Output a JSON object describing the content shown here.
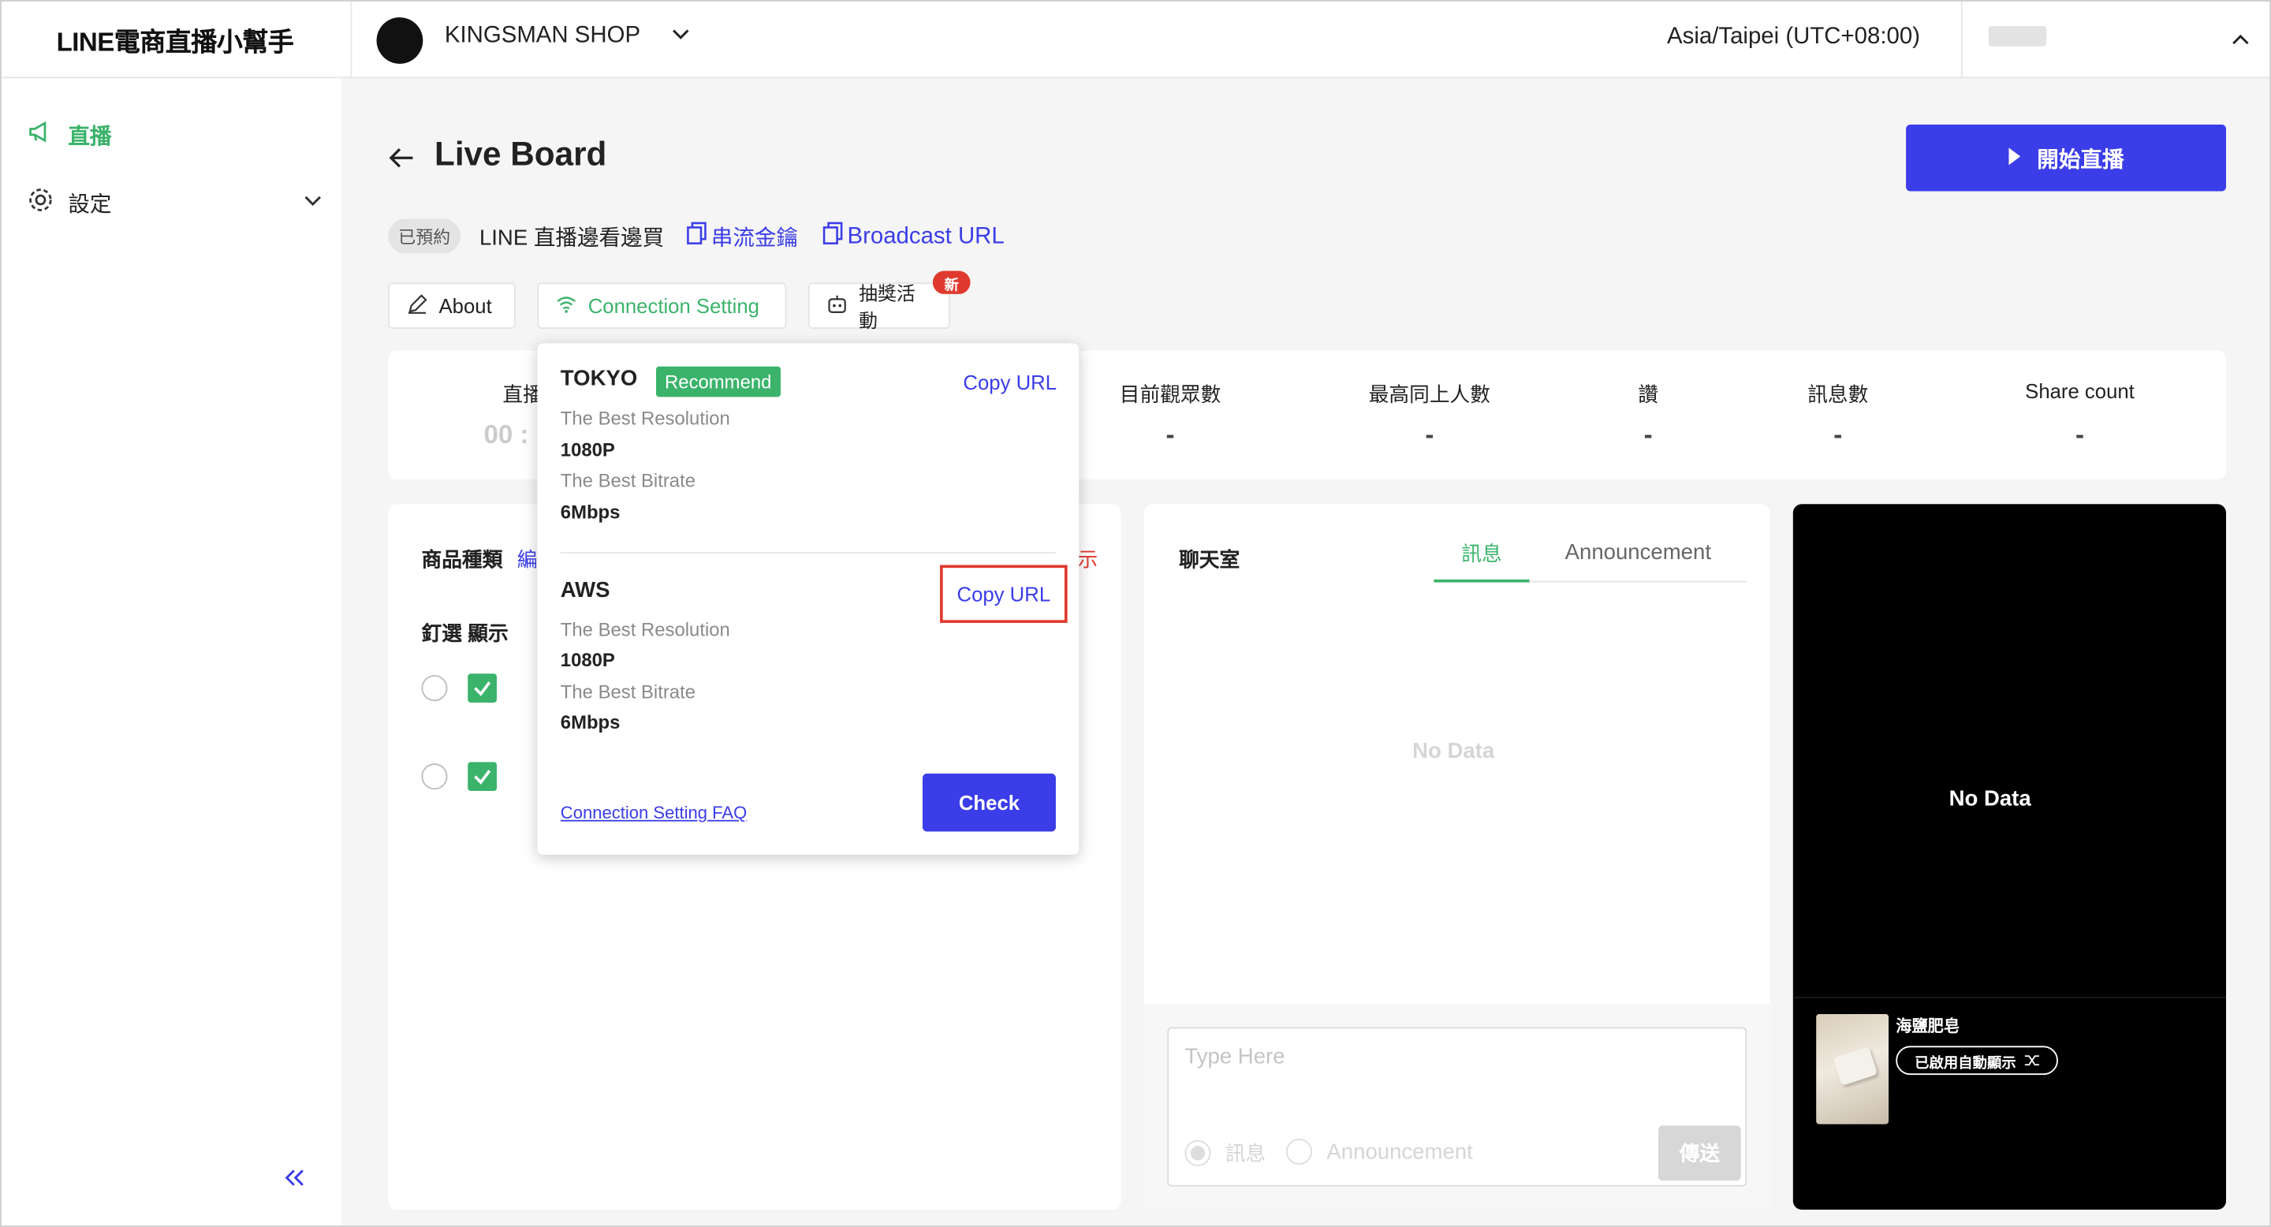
{
  "header": {
    "logo": "LINE電商直播小幫手",
    "shop_name": "KINGSMAN SHOP",
    "timezone": "Asia/Taipei (UTC+08:00)"
  },
  "sidebar": {
    "items": [
      {
        "label": "直播",
        "icon": "megaphone-icon"
      },
      {
        "label": "設定",
        "icon": "gear-icon"
      }
    ]
  },
  "page": {
    "title": "Live Board",
    "start_button": "開始直播",
    "status_badge": "已預約",
    "live_name": "LINE 直播邊看邊買",
    "stream_key_link": "串流金鑰",
    "broadcast_url_link": "Broadcast URL"
  },
  "tabs": {
    "about": "About",
    "connection": "Connection Setting",
    "lottery": "抽獎活動",
    "new_badge": "新"
  },
  "stats": {
    "items": [
      {
        "label": "直播",
        "value": "00 :"
      },
      {
        "label": "目前觀眾數",
        "value": "-"
      },
      {
        "label": "最高同上人數",
        "value": "-"
      },
      {
        "label": "讚",
        "value": "-"
      },
      {
        "label": "訊息數",
        "value": "-"
      },
      {
        "label": "Share count",
        "value": "-"
      }
    ]
  },
  "products": {
    "title": "商品種類",
    "edit": "編",
    "show_suffix": "示",
    "pin_label": "釘選",
    "display_label": "顯示"
  },
  "chat": {
    "title": "聊天室",
    "tab_messages": "訊息",
    "tab_announcement": "Announcement",
    "empty": "No Data",
    "placeholder": "Type Here",
    "radio_message": "訊息",
    "radio_announcement": "Announcement",
    "send": "傳送"
  },
  "video": {
    "empty": "No Data",
    "product_name": "海鹽肥皂",
    "auto_display": "已啟用自動顯示"
  },
  "popup": {
    "servers": [
      {
        "name": "TOKYO",
        "badge": "Recommend",
        "copy": "Copy URL",
        "res_label": "The Best Resolution",
        "res": "1080P",
        "bitrate_label": "The Best Bitrate",
        "bitrate": "6Mbps"
      },
      {
        "name": "AWS",
        "badge": "",
        "copy": "Copy URL",
        "res_label": "The Best Resolution",
        "res": "1080P",
        "bitrate_label": "The Best Bitrate",
        "bitrate": "6Mbps"
      }
    ],
    "faq": "Connection Setting FAQ",
    "check": "Check"
  },
  "colors": {
    "accent": "#3b3de8",
    "green": "#3bb36b",
    "highlight": "#e03a2f"
  }
}
